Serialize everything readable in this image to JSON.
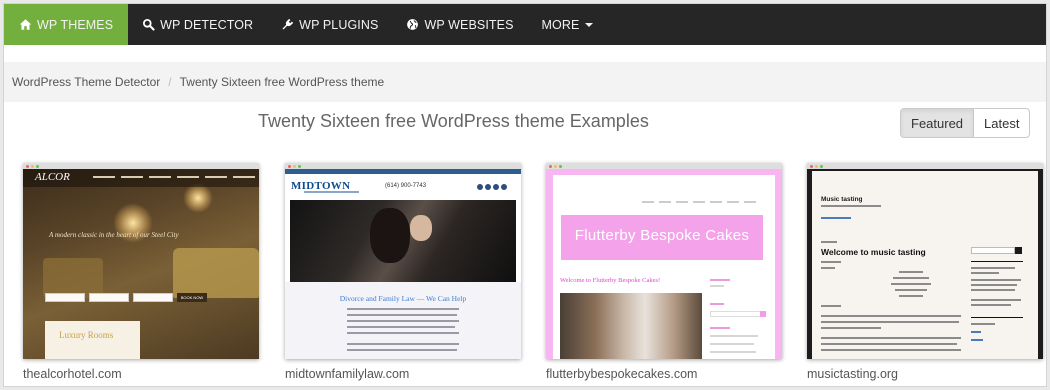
{
  "nav": {
    "items": [
      {
        "label": "WP THEMES",
        "icon": "home-icon",
        "active": true
      },
      {
        "label": "WP DETECTOR",
        "icon": "search-icon",
        "active": false
      },
      {
        "label": "WP PLUGINS",
        "icon": "plug-icon",
        "active": false
      },
      {
        "label": "WP WEBSITES",
        "icon": "globe-icon",
        "active": false
      },
      {
        "label": "MORE",
        "icon": "caret-down-icon",
        "active": false
      }
    ]
  },
  "breadcrumb": {
    "items": [
      "WordPress Theme Detector",
      "Twenty Sixteen free WordPress theme"
    ],
    "separator": "/"
  },
  "heading": "Twenty Sixteen free WordPress theme Examples",
  "toggle": {
    "options": [
      "Featured",
      "Latest"
    ],
    "selected": "Featured"
  },
  "colors": {
    "navbar": "#262626",
    "active_nav": "#72af3c",
    "page_bg": "#ffffff"
  },
  "cards": [
    {
      "domain": "thealcorhotel.com",
      "screenshot": {
        "logo": "ALCOR",
        "tagline": "A modern classic in the heart of our Steel City",
        "section_title": "Luxury Rooms",
        "button": "BOOK NOW"
      }
    },
    {
      "domain": "midtownfamilylaw.com",
      "screenshot": {
        "logo": "MIDTOWN",
        "phone": "(614) 900-7743",
        "section_title": "Divorce and Family Law — We Can Help"
      }
    },
    {
      "domain": "flutterbybespokecakes.com",
      "screenshot": {
        "banner": "Flutterby Bespoke Cakes",
        "section_title": "Welcome to Flutterby Bespoke Cakes!"
      }
    },
    {
      "domain": "musictasting.org",
      "screenshot": {
        "site_title": "Music tasting",
        "post_title": "Welcome to music tasting"
      }
    }
  ]
}
